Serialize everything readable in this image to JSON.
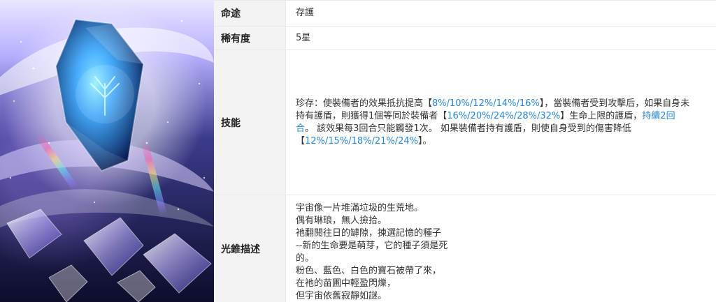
{
  "artwork": {
    "alt": ""
  },
  "rows": [
    {
      "label": "命途",
      "value": "存護"
    },
    {
      "label": "稀有度",
      "value": "5星"
    },
    {
      "label": "技能",
      "skill": {
        "p1": "珍存：使裝備者的效果抵抗提高【",
        "h1": "8%/10%/12%/14%/16%",
        "p2": "】，當裝備者受到攻擊后，如果自身未持有護盾，則獲得1個等同於裝備者【",
        "h2": "16%/20%/24%/28%/32%",
        "p3": "】生命上限的護盾，",
        "h3": "持續2回合",
        "p4": "。 該效果每3回合只能觸發1次。 如果裝備者持有護盾，則使自身受到的傷害降低【",
        "h4": "12%/15%/18%/21%/24%",
        "p5": "】。"
      }
    },
    {
      "label": "光錐描述",
      "lines": [
        "宇宙像一片堆滿垃圾的生荒地。",
        "偶有琳琅，無人撿拾。",
        "祂翻閱往日的罅隙，揀選記憶的種子",
        "--新的生命要是萌芽，它的種子須是死",
        "的。",
        "粉色、藍色、白色的寶石被帶了來，",
        "在祂的苗圃中輕盈閃爍，",
        "但宇宙依舊寂靜如謎。"
      ]
    }
  ]
}
